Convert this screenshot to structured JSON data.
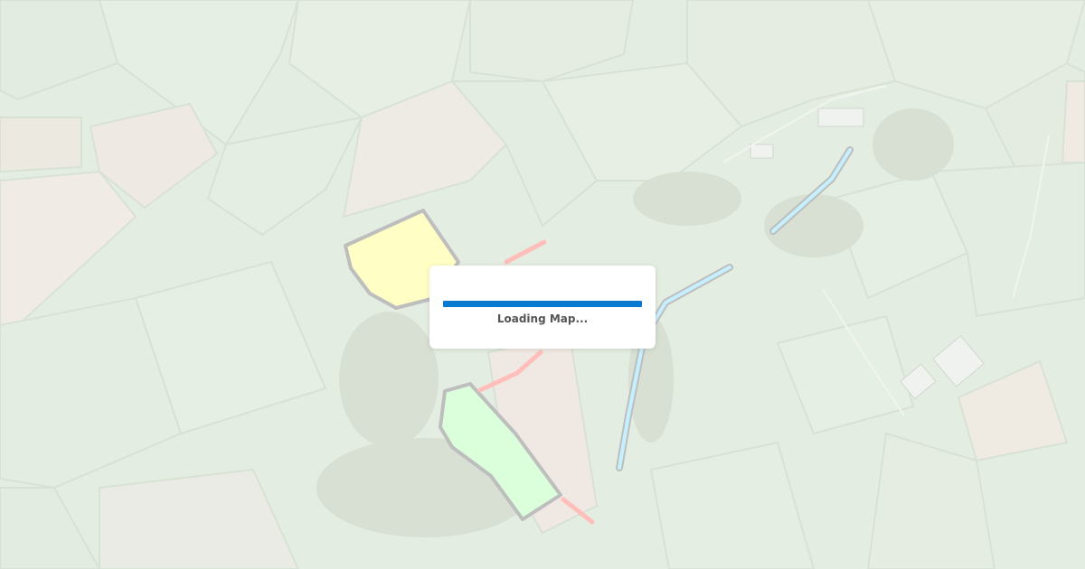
{
  "loader": {
    "text": "Loading Map...",
    "progress": 1.0,
    "bar_color": "#0a7ad1"
  },
  "map": {
    "basemap": "satellite-imagery",
    "overlay_colors": {
      "yellow_field": "#ffffa6",
      "green_field": "#c6ffc6",
      "route_red": "#ff9c96",
      "stream_blue": "#a5e9ff",
      "outline": "#9b9b9b"
    }
  }
}
